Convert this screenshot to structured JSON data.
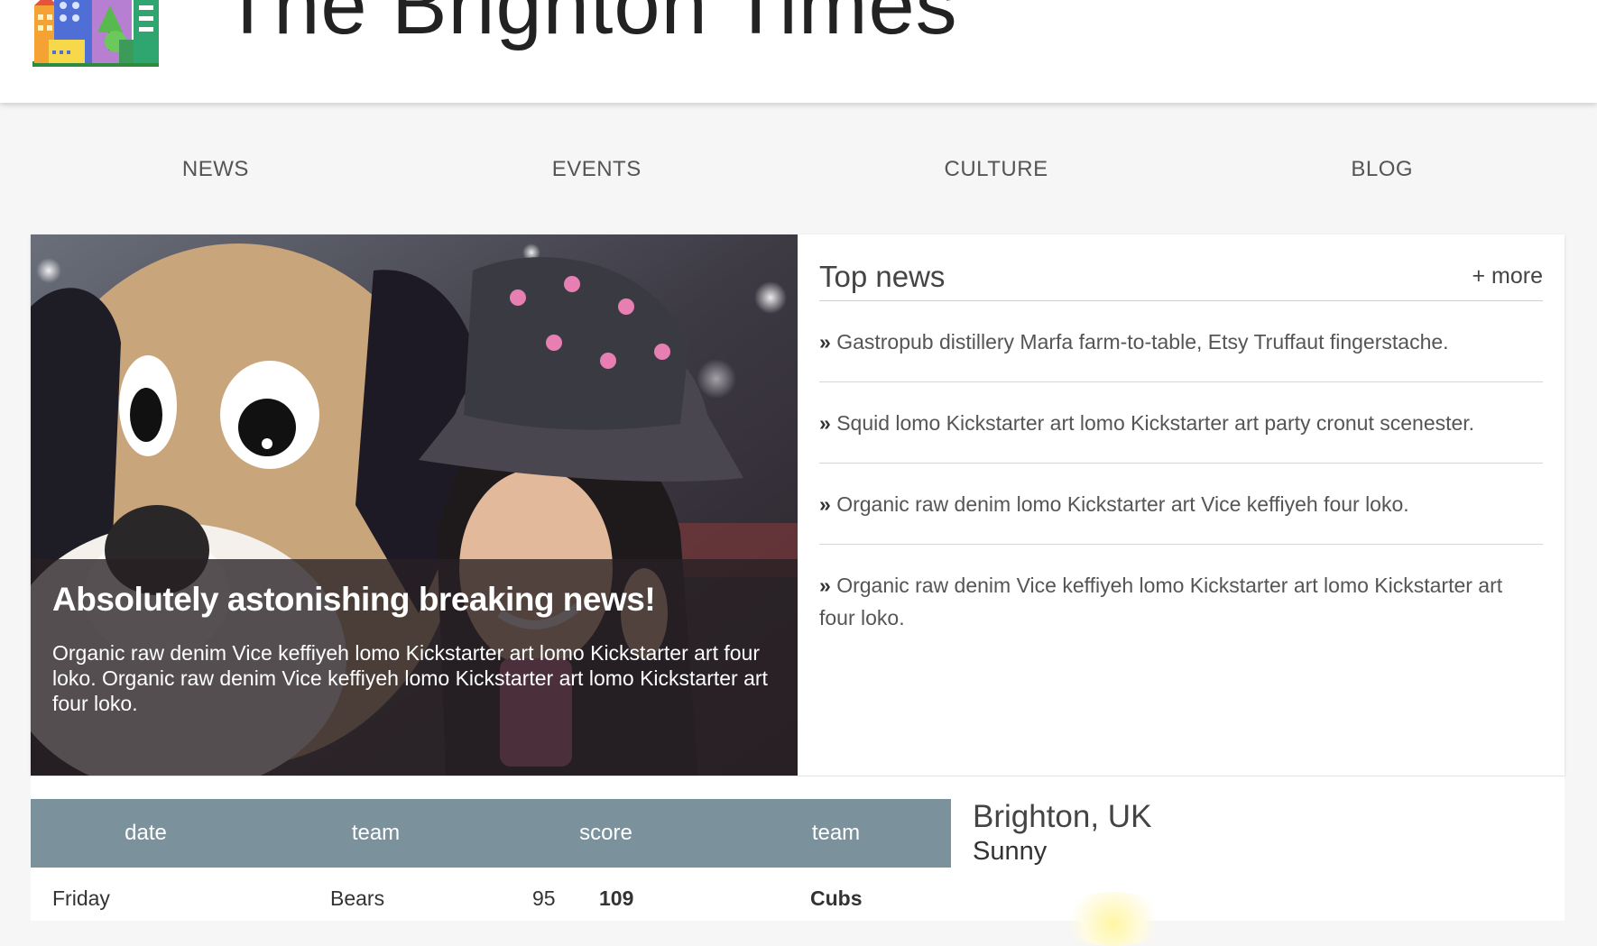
{
  "header": {
    "title": "The Brighton Times",
    "logo_icon": "city-buildings-logo-icon"
  },
  "nav": {
    "items": [
      "NEWS",
      "EVENTS",
      "CULTURE",
      "BLOG"
    ]
  },
  "hero": {
    "image_icon": "mascot-dog-and-woman-photo",
    "headline": "Absolutely astonishing breaking news!",
    "summary": "Organic raw denim Vice keffiyeh lomo Kickstarter art lomo Kickstarter art four loko. Organic raw denim Vice keffiyeh lomo Kickstarter art lomo Kickstarter art four loko."
  },
  "top_news": {
    "title": "Top news",
    "more_label": "+ more",
    "bullet": "»",
    "items": [
      "Gastropub distillery Marfa farm-to-table, Etsy Truffaut fingerstache.",
      "Squid lomo Kickstarter art lomo Kickstarter art party cronut scenester.",
      "Organic raw denim lomo Kickstarter art Vice keffiyeh four loko.",
      "Organic raw denim Vice keffiyeh lomo Kickstarter art lomo Kickstarter art four loko."
    ]
  },
  "scores": {
    "headers": [
      "date",
      "team",
      "score",
      "team"
    ],
    "rows": [
      {
        "date": "Friday",
        "team_a": "Bears",
        "score_a": "95",
        "score_b": "109",
        "team_b": "Cubs"
      }
    ]
  },
  "weather": {
    "city": "Brighton, UK",
    "condition": "Sunny",
    "icon": "sun-icon"
  },
  "colors": {
    "table_header": "#7b919c",
    "overlay": "#282024"
  }
}
